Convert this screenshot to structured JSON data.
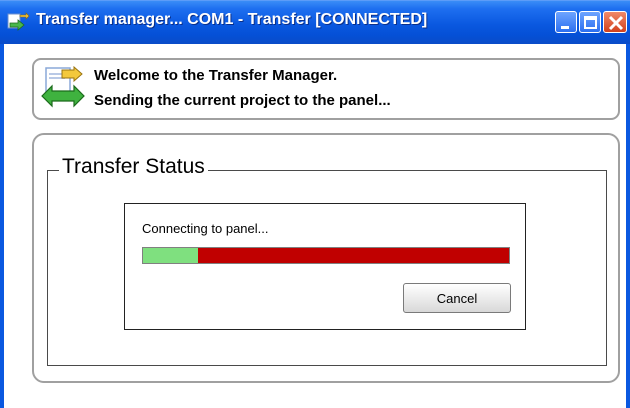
{
  "window": {
    "title": "Transfer manager... COM1 - Transfer [CONNECTED]",
    "controls": {
      "minimize": "minimize-icon",
      "maximize": "maximize-icon",
      "close": "close-icon"
    }
  },
  "header": {
    "icon": "transfer-arrows-icon",
    "welcome": "Welcome to the Transfer Manager.",
    "sending": "Sending the current project to the panel..."
  },
  "status": {
    "group_title": "Transfer Status",
    "message": "Connecting to panel...",
    "progress_fraction": 0.15,
    "progress_colors": {
      "done": "#7fe07f",
      "remaining": "#c00000"
    },
    "cancel_label": "Cancel"
  },
  "colors": {
    "titlebar": "#0a58e0"
  }
}
